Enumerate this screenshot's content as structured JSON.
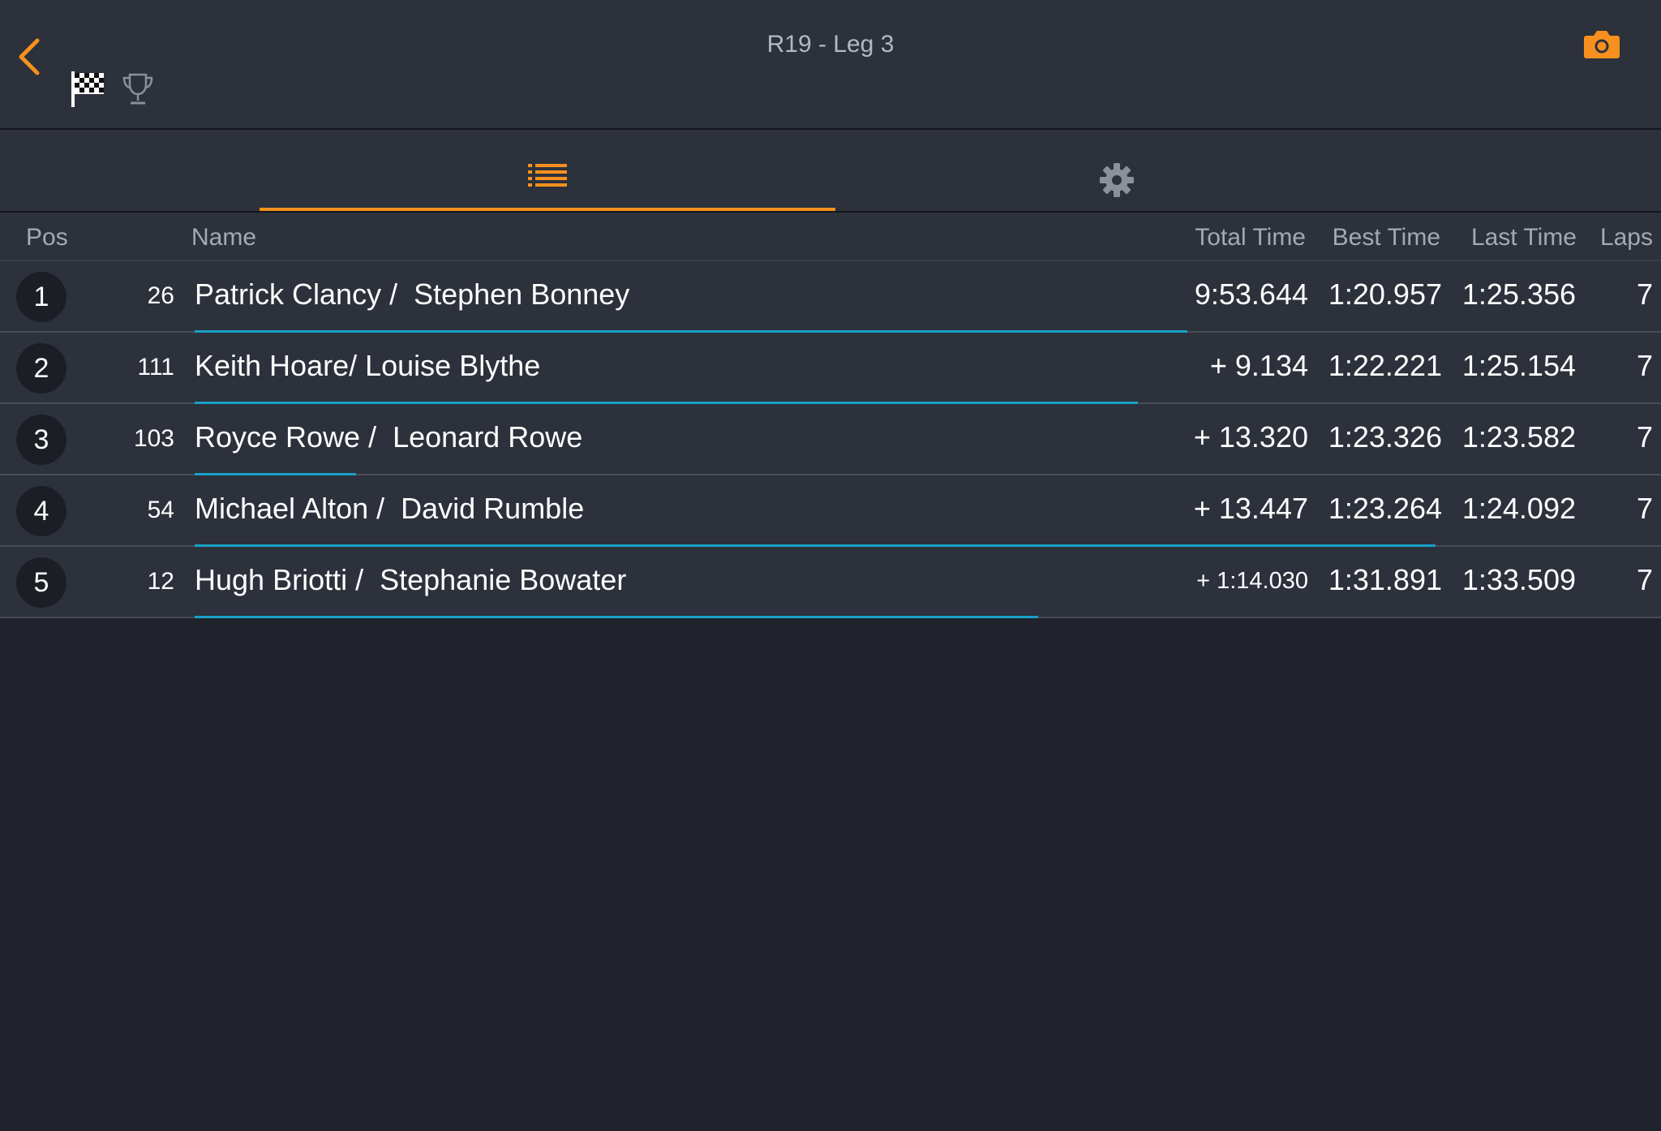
{
  "header": {
    "title": "R19 - Leg 3",
    "icons": [
      "back-chevron-icon",
      "checkered-flag-icon",
      "trophy-icon",
      "camera-icon"
    ],
    "accent_color": "#f7901e"
  },
  "tabs": [
    {
      "name": "list-icon",
      "active": true
    },
    {
      "name": "gear-icon",
      "active": false
    }
  ],
  "columns": {
    "pos": "Pos",
    "name": "Name",
    "total_time": "Total Time",
    "best_time": "Best Time",
    "last_time": "Last Time",
    "laps": "Laps"
  },
  "rows": [
    {
      "pos": "1",
      "car": "26",
      "name": "Patrick Clancy /  Stephen Bonney",
      "total": "9:53.644",
      "best": "1:20.957",
      "last": "1:25.356",
      "laps": "7",
      "progress": 0.8
    },
    {
      "pos": "2",
      "car": "111",
      "name": "Keith Hoare/ Louise Blythe",
      "total": "+ 9.134",
      "best": "1:22.221",
      "last": "1:25.154",
      "laps": "7",
      "progress": 0.76
    },
    {
      "pos": "3",
      "car": "103",
      "name": "Royce Rowe /  Leonard Rowe",
      "total": "+ 13.320",
      "best": "1:23.326",
      "last": "1:23.582",
      "laps": "7",
      "progress": 0.13
    },
    {
      "pos": "4",
      "car": "54",
      "name": "Michael Alton /  David Rumble",
      "total": "+ 13.447",
      "best": "1:23.264",
      "last": "1:24.092",
      "laps": "7",
      "progress": 1.0
    },
    {
      "pos": "5",
      "car": "12",
      "name": "Hugh Briotti /  Stephanie Bowater",
      "total": "+ 1:14.030",
      "best": "1:31.891",
      "last": "1:33.509",
      "laps": "7",
      "progress": 0.68
    }
  ]
}
